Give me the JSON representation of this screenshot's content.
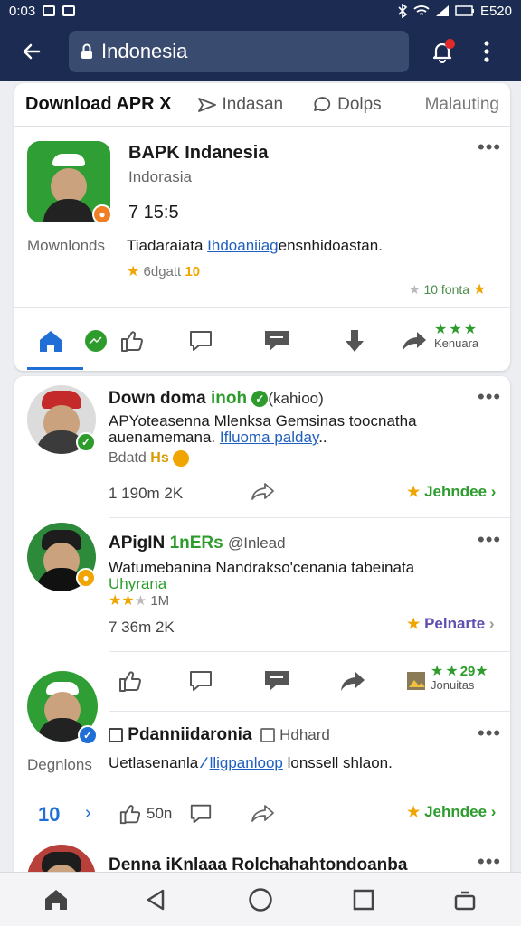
{
  "status": {
    "time": "0:03",
    "battery": "E520"
  },
  "appbar": {
    "search_value": "Indonesia"
  },
  "tabs": {
    "t0": "Download APR X",
    "t1": "Indasan",
    "t2": "Dolps",
    "t3": "Malauting"
  },
  "post1": {
    "name": "BAPK Indanesia",
    "sub": "Indorasia",
    "stat": "7 15:5",
    "left_label": "Mownlonds",
    "text_a": "Tiadaraiata",
    "link": "Ihdoaniiag",
    "text_b": "ensnhidoastan.",
    "rating": "6dgatt",
    "rating_badge": "10",
    "right_rating": "10 fonta",
    "action_label": "Kenuara"
  },
  "post2": {
    "name": "Down doma",
    "name_green": "inoh",
    "name_tag": "(kahioo)",
    "line1": "APYoteasenna Mlenksa Gemsinas toocnatha",
    "line2_a": "auenamemana.",
    "line2_link": "Ifluoma palday",
    "line2_b": "..",
    "meta": "Bdatd",
    "meta_b": "Hs",
    "counts": "1   190m 2K",
    "cta": "Jehndee"
  },
  "post3": {
    "name": "APigIN",
    "name_green": "1nERs",
    "name_tag": "@Inlead",
    "line1": "Watumebanina Nandrakso'cenania tabeinata",
    "line2": "Uhyrana",
    "rating_text": "1M",
    "counts": "7   36m 2K",
    "cta": "Pelnarte",
    "action_label": "Jonuitas",
    "action_stars": "29"
  },
  "post4": {
    "name": "Pdanniidaronia",
    "tag": "Hdhard",
    "left_label": "Degnlons",
    "text_a": "Uetlasenanla",
    "link": "lligpanloop",
    "text_b": "lonssell shlaon.",
    "count_num": "10",
    "likes": "50n",
    "cta": "Jehndee"
  },
  "post5": {
    "name": "Denna iKnlaaa Rolchahahtondoanba"
  },
  "colors": {
    "appbar": "#1b2b52",
    "accent_blue": "#1f6fd6",
    "green": "#2d9c2d",
    "star": "#f0a500"
  }
}
